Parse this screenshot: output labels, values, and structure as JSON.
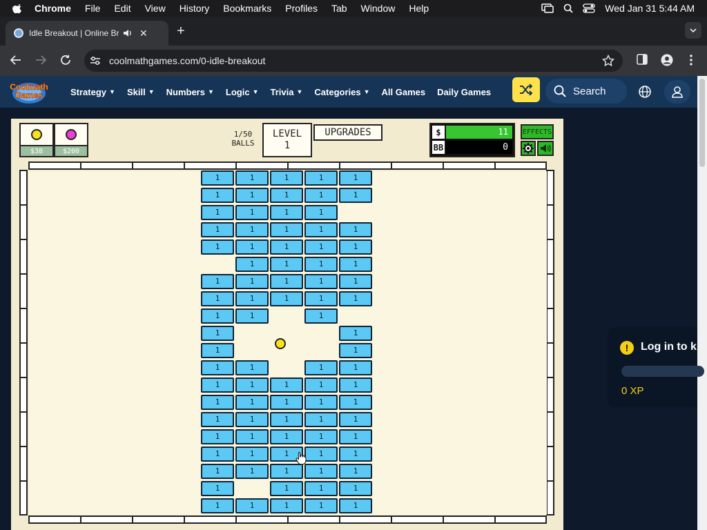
{
  "menubar": {
    "app": "Chrome",
    "items": [
      "File",
      "Edit",
      "View",
      "History",
      "Bookmarks",
      "Profiles",
      "Tab",
      "Window",
      "Help"
    ],
    "clock": "Wed Jan 31  5:44 AM"
  },
  "tab": {
    "title": "Idle Breakout | Online Bric"
  },
  "address": {
    "url": "coolmathgames.com/0-idle-breakout"
  },
  "site": {
    "logo_line1": "Coolmath",
    "logo_line2": "Games",
    "nav": [
      {
        "label": "Strategy",
        "dropdown": true
      },
      {
        "label": "Skill",
        "dropdown": true
      },
      {
        "label": "Numbers",
        "dropdown": true
      },
      {
        "label": "Logic",
        "dropdown": true
      },
      {
        "label": "Trivia",
        "dropdown": true
      },
      {
        "label": "Categories",
        "dropdown": true
      },
      {
        "label": "All Games",
        "dropdown": false
      },
      {
        "label": "Daily Games",
        "dropdown": false
      }
    ],
    "search_label": "Search"
  },
  "game": {
    "ball_shop": [
      {
        "price": "$38",
        "color": "#f7e21c"
      },
      {
        "price": "$200",
        "color": "#e93fd6"
      }
    ],
    "balls_count": "1/50",
    "balls_label": "BALLS",
    "level_label": "LEVEL",
    "level_value": "1",
    "upgrades_label": "UPGRADES",
    "money_symbol": "$",
    "money_value": "11",
    "bb_symbol": "BB",
    "bb_value": "0",
    "effects_label": "EFFECTS",
    "brick_value": "1",
    "brick_rows": [
      [
        0,
        1,
        2,
        3,
        4
      ],
      [
        0,
        1,
        2,
        3,
        4
      ],
      [
        0,
        1,
        2,
        3
      ],
      [
        0,
        1,
        2,
        3,
        4
      ],
      [
        0,
        1,
        2,
        3,
        4
      ],
      [
        1,
        2,
        3,
        4
      ],
      [
        0,
        1,
        2,
        3,
        4
      ],
      [
        0,
        1,
        2,
        3,
        4
      ],
      [
        0,
        1,
        3
      ],
      [
        0,
        4
      ],
      [
        0,
        4
      ],
      [
        0,
        1,
        3,
        4
      ],
      [
        0,
        1,
        2,
        3,
        4
      ],
      [
        0,
        1,
        2,
        3,
        4
      ],
      [
        0,
        1,
        2,
        3,
        4
      ],
      [
        0,
        1,
        2,
        3,
        4
      ],
      [
        0,
        1,
        2,
        3,
        4
      ],
      [
        0,
        1,
        2,
        3,
        4
      ],
      [
        0,
        2,
        3,
        4
      ],
      [
        0,
        1,
        2,
        3,
        4
      ]
    ]
  },
  "xp_panel": {
    "login_text": "Log in to k",
    "xp_text": "0 XP"
  },
  "colors": {
    "nav_bg": "#163556",
    "shuffle_bg": "#ffe24a",
    "brick": "#5cc8f4",
    "money_green": "#38c531",
    "effects_green": "#2fb82a"
  }
}
